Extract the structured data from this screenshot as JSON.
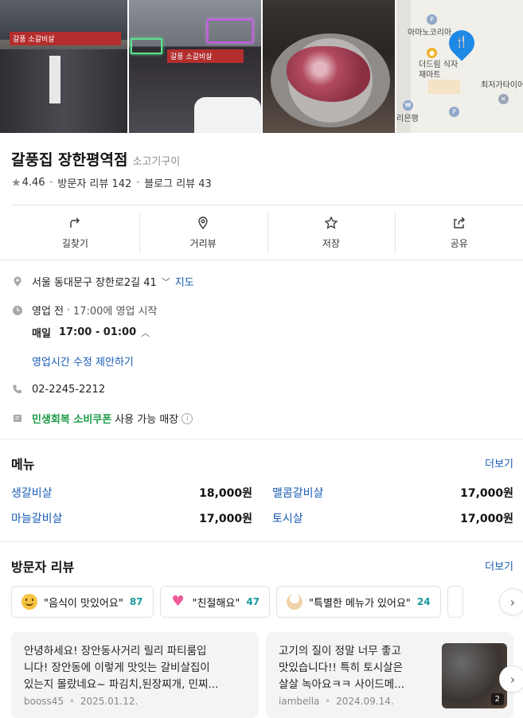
{
  "photos": {
    "sign1": "갈풍 소갈비살",
    "sign2": "갈풍 소갈비살",
    "map": {
      "label1": "아마노코리아",
      "label2": "더드림 식자재마트",
      "label3": "최저가타이어",
      "label4": "리은행"
    }
  },
  "place": {
    "name": "갈풍집 장한평역점",
    "category": "소고기구이",
    "rating": "4.46",
    "visitor_reviews": "방문자 리뷰 142",
    "blog_reviews": "블로그 리뷰 43"
  },
  "actions": [
    {
      "label": "길찾기",
      "icon": "directions-icon"
    },
    {
      "label": "거리뷰",
      "icon": "location-pin-icon"
    },
    {
      "label": "저장",
      "icon": "star-icon"
    },
    {
      "label": "공유",
      "icon": "share-icon"
    }
  ],
  "info": {
    "address": "서울 동대문구 장한로2길 41",
    "map_link": "지도",
    "status": "영업 전",
    "status_detail": "17:00에 영업 시작",
    "hours_day": "매일",
    "hours": "17:00 - 01:00",
    "suggest_edit": "영업시간 수정 제안하기",
    "phone": "02-2245-2212",
    "coupon_name": "민생회복 소비쿠폰",
    "coupon_suffix": "사용 가능 매장"
  },
  "menu": {
    "title": "메뉴",
    "more": "더보기",
    "items": [
      {
        "name": "생갈비살",
        "price": "18,000원"
      },
      {
        "name": "맬콤갈비살",
        "price": "17,000원"
      },
      {
        "name": "마늘갈비살",
        "price": "17,000원"
      },
      {
        "name": "토시살",
        "price": "17,000원"
      }
    ]
  },
  "reviews": {
    "title": "방문자 리뷰",
    "more": "더보기",
    "keywords": [
      {
        "label": "\"음식이 맛있어요\"",
        "count": "87",
        "icon": "smile-emoji-icon",
        "color": "#f6c342"
      },
      {
        "label": "\"친절해요\"",
        "count": "47",
        "icon": "heart-emoji-icon",
        "color": "#f48fb1"
      },
      {
        "label": "\"특별한 메뉴가 있어요\"",
        "count": "24",
        "icon": "chef-emoji-icon",
        "color": "#f0d2a8"
      }
    ],
    "cards": [
      {
        "line1": "안녕하세요! 장안동사거리 릴리 파티룸입",
        "line2": "니다! 장안동에 이렇게 맛잇는 갈비살집이",
        "line3": "있는지 몰랐네요~ 파김치,된장찌개, 민찌...",
        "author": "booss45",
        "date": "2025.01.12."
      },
      {
        "line1": "고기의 질이 정말 너무 좋고",
        "line2": "맛있습니다!! 특히 토시살은",
        "line3": "살살 녹아요ㅋㅋ 사이드메...",
        "author": "iambella",
        "date": "2024.09.14.",
        "photo_count": "2"
      }
    ]
  }
}
